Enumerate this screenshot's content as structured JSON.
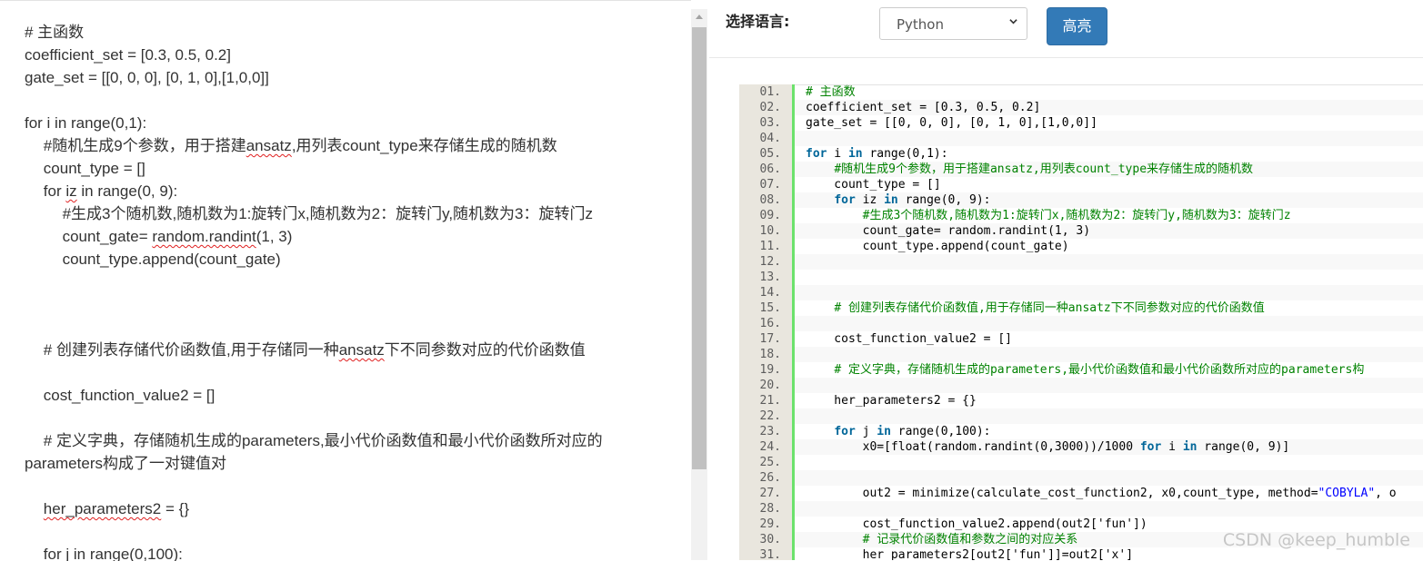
{
  "left_editor": {
    "lines": [
      "# 主函数",
      "coefficient_set = [0.3, 0.5, 0.2]",
      "gate_set = [[0, 0, 0], [0, 1, 0],[1,0,0]]",
      "",
      "for i in range(0,1):",
      "    #随机生成9个参数，用于搭建ansatz,用列表count_type来存储生成的随机数",
      "    count_type = []",
      "    for iz in range(0, 9):",
      "        #生成3个随机数,随机数为1:旋转门x,随机数为2：旋转门y,随机数为3：旋转门z",
      "        count_gate= random.randint(1, 3)",
      "        count_type.append(count_gate)",
      "",
      "",
      "",
      "    # 创建列表存储代价函数值,用于存储同一种ansatz下不同参数对应的代价函数值",
      "",
      "    cost_function_value2 = []",
      "",
      "    # 定义字典，存储随机生成的parameters,最小代价函数值和最小代价函数所对应的",
      "parameters构成了一对键值对",
      "",
      "    her_parameters2 = {}",
      "",
      "    for j in range(0,100):"
    ]
  },
  "toolbar": {
    "label": "选择语言:",
    "language_selected": "Python",
    "highlight_button": "高亮"
  },
  "code_viewer": {
    "line_numbers": [
      "01.",
      "02.",
      "03.",
      "04.",
      "05.",
      "06.",
      "07.",
      "08.",
      "09.",
      "10.",
      "11.",
      "12.",
      "13.",
      "14.",
      "15.",
      "16.",
      "17.",
      "18.",
      "19.",
      "20.",
      "21.",
      "22.",
      "23.",
      "24.",
      "25.",
      "26.",
      "27.",
      "28.",
      "29.",
      "30.",
      "31."
    ],
    "lines": [
      "# 主函数",
      "coefficient_set = [0.3, 0.5, 0.2]",
      "gate_set = [[0, 0, 0], [0, 1, 0],[1,0,0]]",
      "",
      "for i in range(0,1):",
      "    #随机生成9个参数，用于搭建ansatz,用列表count_type来存储生成的随机数",
      "    count_type = []",
      "    for iz in range(0, 9):",
      "        #生成3个随机数,随机数为1:旋转门x,随机数为2：旋转门y,随机数为3：旋转门z",
      "        count_gate= random.randint(1, 3)",
      "        count_type.append(count_gate)",
      "",
      "",
      "",
      "    # 创建列表存储代价函数值,用于存储同一种ansatz下不同参数对应的代价函数值",
      "",
      "    cost_function_value2 = []",
      "",
      "    # 定义字典，存储随机生成的parameters,最小代价函数值和最小代价函数所对应的parameters构",
      "",
      "    her_parameters2 = {}",
      "",
      "    for j in range(0,100):",
      "        x0=[float(random.randint(0,3000))/1000 for i in range(0, 9)]",
      "",
      "",
      "        out2 = minimize(calculate_cost_function2, x0,count_type, method=\"COBYLA\", o",
      "",
      "        cost_function_value2.append(out2['fun'])",
      "        # 记录代价函数值和参数之间的对应关系",
      "        her_parameters2[out2['fun']]=out2['x']"
    ]
  },
  "watermark": "CSDN @keep_humble",
  "colors": {
    "button": "#337ab7",
    "keyword": "#006699",
    "comment": "#008200",
    "string": "#0000ff",
    "gutter": "#e9e6de",
    "gutter_border": "#6ce26c"
  }
}
